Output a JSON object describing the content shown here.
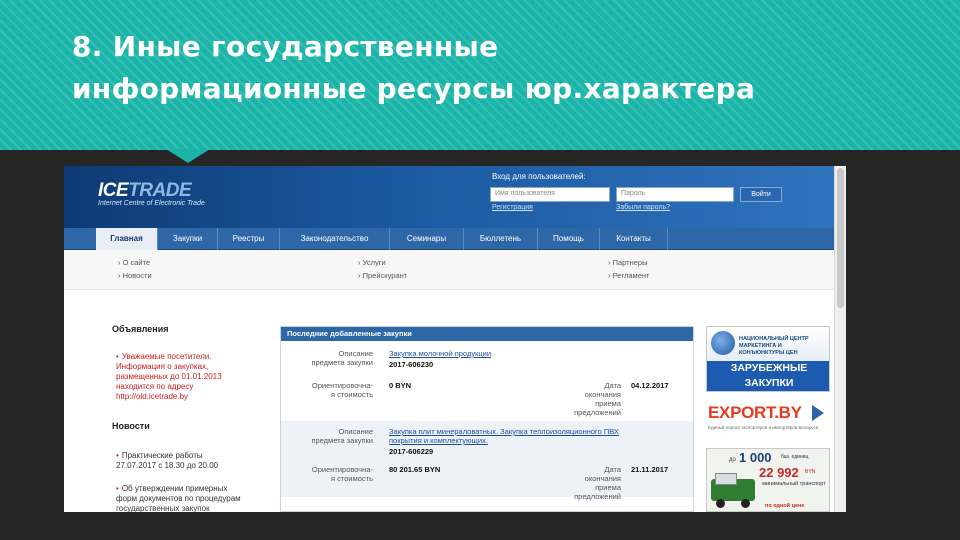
{
  "slide": {
    "title_line1": "8. Иные государственные",
    "title_line2": "информационные ресурсы юр.характера"
  },
  "site": {
    "logo_ice": "ICE",
    "logo_trade": "TRADE",
    "logo_sub": "Internet Centre of Electronic Trade"
  },
  "login": {
    "title": "Вход для пользователей:",
    "username_placeholder": "Имя пользователя",
    "password_placeholder": "Пароль",
    "button": "Войти",
    "register": "Регистрация",
    "forgot": "Забыли пароль?"
  },
  "nav": [
    "Главная",
    "Закупки",
    "Реестры",
    "Законодательство",
    "Семинары",
    "Бюллетень",
    "Помощь",
    "Контакты"
  ],
  "sub_links": {
    "col1": [
      "О сайте",
      "Новости"
    ],
    "col2": [
      "Услуги",
      "Прейскурант"
    ],
    "col3": [
      "Партнеры",
      "Регламент"
    ]
  },
  "sidebar": {
    "ads_title": "Объявления",
    "ads_item": [
      "Уважаемые посетители.",
      "Информация о закупках,",
      "размещенных до 01.01.2013",
      "находится по адресу",
      "http://old.icetrade.by"
    ],
    "news_title": "Новости",
    "news_item1": [
      "Практические работы",
      "27.07.2017 с 18.30 до 20.00"
    ],
    "news_item2": [
      "Об утверждении примерных",
      "форм документов по процедурам",
      "государственных закупок"
    ]
  },
  "panel": {
    "title": "Последние добавленные закупки",
    "rows": [
      {
        "desc_label_1": "Описание",
        "desc_label_2": "предмета закупки",
        "subject": "Закупка молочной продукции",
        "number": "2017-606230",
        "cost_label_1": "Ориентировочна-",
        "cost_label_2": "я стоимость",
        "cost": "0 BYN",
        "date_label_1": "Дата",
        "date_label_2": "окончания",
        "date_label_3": "приема",
        "date_label_4": "предложений",
        "date": "04.12.2017"
      },
      {
        "desc_label_1": "Описание",
        "desc_label_2": "предмета закупки",
        "subject_1": "Закупка плит минераловатных. Закупка теплоизоляционного ПВХ",
        "subject_2": "покрытия и комплектующих.",
        "number": "2017-606229",
        "cost_label_1": "Ориентировочна-",
        "cost_label_2": "я стоимость",
        "cost": "80 201.65 BYN",
        "date_label_1": "Дата",
        "date_label_2": "окончания",
        "date_label_3": "приема",
        "date_label_4": "предложений",
        "date": "21.11.2017"
      }
    ]
  },
  "banners": {
    "b1_top": "НАЦИОНАЛЬНЫЙ ЦЕНТР МАРКЕТИНГА И КОНЪЮНКТУРЫ ЦЕН",
    "b1_line1": "ЗАРУБЕЖНЫЕ",
    "b1_line2": "ЗАКУПКИ",
    "b2_title": "EXPORT.BY",
    "b2_sub": "Единый портал экспортёров и импортёров Беларуси",
    "b3_pre": "до",
    "b3_big1": "1 000",
    "b3_unit1": "баз. единиц",
    "b3_big2": "22 992",
    "b3_unit2": "BYN",
    "b3_desc": "минимальный транспорт",
    "b3_tag": "по одной цене"
  }
}
